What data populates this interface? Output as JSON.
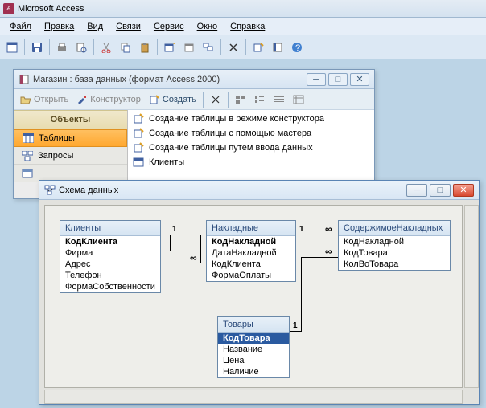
{
  "app": {
    "title": "Microsoft Access"
  },
  "menu": {
    "file": "Файл",
    "edit": "Правка",
    "view": "Вид",
    "relations": "Связи",
    "service": "Сервис",
    "window": "Окно",
    "help": "Справка"
  },
  "dbwin": {
    "title": "Магазин : база данных (формат Access 2000)",
    "open": "Открыть",
    "designer": "Конструктор",
    "create": "Создать",
    "nav_header": "Объекты",
    "nav_tables": "Таблицы",
    "nav_queries": "Запросы",
    "items": {
      "a": "Создание таблицы в режиме конструктора",
      "b": "Создание таблицы с помощью мастера",
      "c": "Создание таблицы путем ввода данных",
      "d": "Клиенты"
    }
  },
  "schema": {
    "title": "Схема данных",
    "tables": {
      "clients": {
        "title": "Клиенты",
        "f0": "КодКлиента",
        "f1": "Фирма",
        "f2": "Адрес",
        "f3": "Телефон",
        "f4": "ФормаСобственности"
      },
      "invoices": {
        "title": "Накладные",
        "f0": "КодНакладной",
        "f1": "ДатаНакладной",
        "f2": "КодКлиента",
        "f3": "ФормаОплаты"
      },
      "goods": {
        "title": "Товары",
        "f0": "КодТовара",
        "f1": "Название",
        "f2": "Цена",
        "f3": "Наличие"
      },
      "contents": {
        "title": "СодержимоеНакладных",
        "f0": "КодНакладной",
        "f1": "КодТовара",
        "f2": "КолВоТовара"
      }
    },
    "one": "1",
    "many": "∞"
  }
}
